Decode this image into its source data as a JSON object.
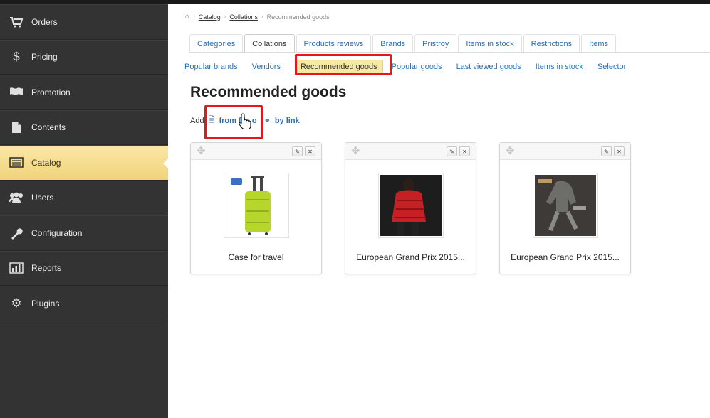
{
  "sidebar": {
    "items": [
      {
        "label": "Orders",
        "icon": "cart-icon"
      },
      {
        "label": "Pricing",
        "icon": "dollar-icon"
      },
      {
        "label": "Promotion",
        "icon": "flag-icon"
      },
      {
        "label": "Contents",
        "icon": "document-icon"
      },
      {
        "label": "Catalog",
        "icon": "list-icon",
        "active": true
      },
      {
        "label": "Users",
        "icon": "users-icon"
      },
      {
        "label": "Configuration",
        "icon": "wrench-icon"
      },
      {
        "label": "Reports",
        "icon": "bar-chart-icon"
      },
      {
        "label": "Plugins",
        "icon": "gear-icon"
      }
    ]
  },
  "breadcrumb": {
    "home_icon": "home-icon",
    "items": [
      "Catalog",
      "Collations",
      "Recommended goods"
    ]
  },
  "tabs": [
    "Categories",
    "Collations",
    "Products reviews",
    "Brands",
    "Pristroy",
    "Items in stock",
    "Restrictions",
    "Items"
  ],
  "active_tab": "Collations",
  "subnav": [
    "Popular brands",
    "Vendors",
    "Recommended goods",
    "Popular goods",
    "Last viewed goods",
    "Items in stock",
    "Selector"
  ],
  "active_subnav": "Recommended goods",
  "page_title": "Recommended goods",
  "add_row": {
    "prefix": "Add",
    "from_file": "from file o",
    "by_link": "by link"
  },
  "products": [
    {
      "name": "Case for travel"
    },
    {
      "name": "European Grand Prix 2015..."
    },
    {
      "name": "European Grand Prix 2015..."
    }
  ],
  "colors": {
    "sidebar_bg": "#333333",
    "active_item": "#f0d47c",
    "link": "#2a6fb5",
    "highlight_box": "#e8151b"
  }
}
